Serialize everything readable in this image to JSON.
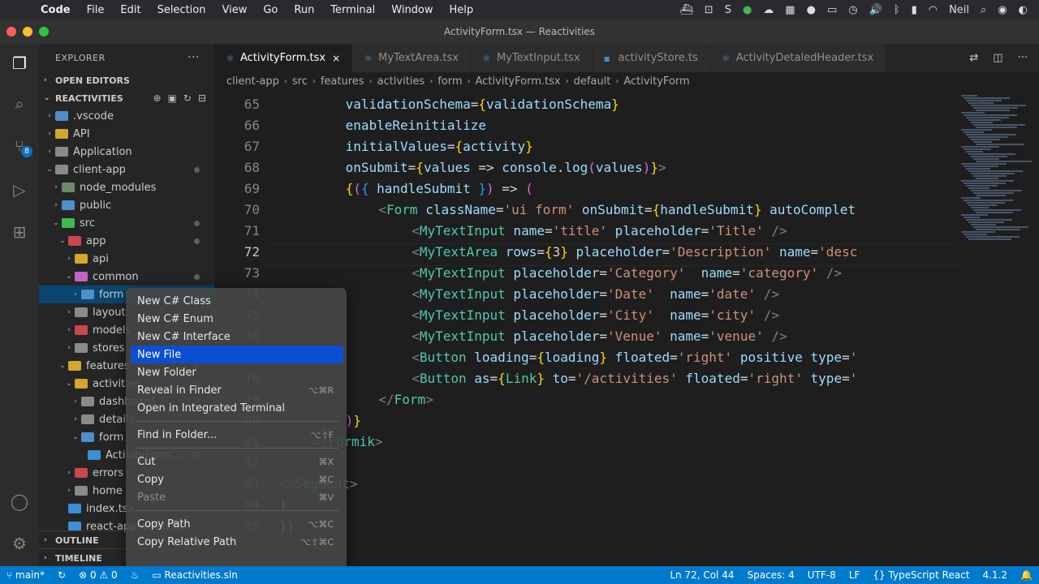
{
  "menubar": {
    "app": "Code",
    "items": [
      "File",
      "Edit",
      "Selection",
      "View",
      "Go",
      "Run",
      "Terminal",
      "Window",
      "Help"
    ],
    "user": "Neil"
  },
  "window": {
    "title": "ActivityForm.tsx — Reactivities"
  },
  "activitybar": {
    "scm_badge": "8"
  },
  "sidebar": {
    "title": "EXPLORER",
    "open_editors": "OPEN EDITORS",
    "project": "REACTIVITIES",
    "tree": [
      {
        "label": ".vscode",
        "depth": 1,
        "chev": "›",
        "color": "#4e8fc9"
      },
      {
        "label": "API",
        "depth": 1,
        "chev": "›",
        "color": "#d4a72c"
      },
      {
        "label": "Application",
        "depth": 1,
        "chev": "›",
        "color": "#8a8a8a"
      },
      {
        "label": "client-app",
        "depth": 1,
        "chev": "⌄",
        "color": "#8a8a8a"
      },
      {
        "label": "node_modules",
        "depth": 2,
        "chev": "›",
        "color": "#6a8a6a"
      },
      {
        "label": "public",
        "depth": 2,
        "chev": "›",
        "color": "#4e8fc9"
      },
      {
        "label": "src",
        "depth": 2,
        "chev": "⌄",
        "color": "#3fb950"
      },
      {
        "label": "app",
        "depth": 3,
        "chev": "⌄",
        "color": "#c9474e"
      },
      {
        "label": "api",
        "depth": 4,
        "chev": "›",
        "color": "#d4a72c"
      },
      {
        "label": "common",
        "depth": 4,
        "chev": "⌄",
        "color": "#c563c5"
      },
      {
        "label": "form",
        "depth": 5,
        "chev": "›",
        "color": "#4e8fc9"
      },
      {
        "label": "layout",
        "depth": 4,
        "chev": "›",
        "color": "#8a8a8a"
      },
      {
        "label": "models",
        "depth": 4,
        "chev": "›",
        "color": "#c9474e"
      },
      {
        "label": "stores",
        "depth": 4,
        "chev": "›",
        "color": "#8a8a8a"
      },
      {
        "label": "features",
        "depth": 3,
        "chev": "⌄",
        "color": "#d4a72c"
      },
      {
        "label": "activities",
        "depth": 4,
        "chev": "⌄",
        "color": "#d4a72c"
      },
      {
        "label": "dashboard",
        "depth": 5,
        "chev": "›",
        "color": "#8a8a8a"
      },
      {
        "label": "details",
        "depth": 5,
        "chev": "›",
        "color": "#8a8a8a"
      },
      {
        "label": "form",
        "depth": 5,
        "chev": "⌄",
        "color": "#4e8fc9"
      },
      {
        "label": "ActivityForm...",
        "depth": 6,
        "chev": "",
        "color": "#3c8fd6",
        "mark": "M"
      },
      {
        "label": "errors",
        "depth": 4,
        "chev": "›",
        "color": "#c9474e"
      },
      {
        "label": "home",
        "depth": 4,
        "chev": "›",
        "color": "#8a8a8a"
      },
      {
        "label": "index.tsx",
        "depth": 3,
        "chev": "",
        "color": "#3c8fd6"
      },
      {
        "label": "react-app-env.d.ts",
        "depth": 3,
        "chev": "",
        "color": "#3c8fd6"
      }
    ],
    "outline": "OUTLINE",
    "timeline": "TIMELINE"
  },
  "tabs": [
    {
      "label": "ActivityForm.tsx",
      "active": true,
      "close": "×"
    },
    {
      "label": "MyTextArea.tsx",
      "active": false
    },
    {
      "label": "MyTextInput.tsx",
      "active": false
    },
    {
      "label": "activityStore.ts",
      "active": false
    },
    {
      "label": "ActivityDetaledHeader.tsx",
      "active": false
    }
  ],
  "breadcrumb": [
    "client-app",
    "src",
    "features",
    "activities",
    "form",
    "ActivityForm.tsx",
    "default",
    "ActivityForm"
  ],
  "editor": {
    "current_line": 72,
    "lines": [
      {
        "n": "65",
        "indent": 8,
        "parts": [
          [
            "k",
            "validationSchema"
          ],
          [
            "w",
            "="
          ],
          [
            "b",
            "{"
          ],
          [
            "k",
            "validationSchema"
          ],
          [
            "b",
            "}"
          ]
        ]
      },
      {
        "n": "66",
        "indent": 8,
        "parts": [
          [
            "k",
            "enableReinitialize"
          ]
        ]
      },
      {
        "n": "67",
        "indent": 8,
        "parts": [
          [
            "k",
            "initialValues"
          ],
          [
            "w",
            "="
          ],
          [
            "b",
            "{"
          ],
          [
            "k",
            "activity"
          ],
          [
            "b",
            "}"
          ]
        ]
      },
      {
        "n": "68",
        "indent": 8,
        "parts": [
          [
            "k",
            "onSubmit"
          ],
          [
            "w",
            "="
          ],
          [
            "b",
            "{"
          ],
          [
            "k",
            "values"
          ],
          [
            "w",
            " => "
          ],
          [
            "k",
            "console"
          ],
          [
            "w",
            "."
          ],
          [
            "k",
            "log"
          ],
          [
            "pk",
            "("
          ],
          [
            "k",
            "values"
          ],
          [
            "pk",
            ")"
          ],
          [
            "b",
            "}"
          ],
          [
            "p",
            ">"
          ]
        ]
      },
      {
        "n": "69",
        "indent": 8,
        "parts": [
          [
            "b",
            "{"
          ],
          [
            "pk",
            "("
          ],
          [
            "bl",
            "{ "
          ],
          [
            "k",
            "handleSubmit"
          ],
          [
            "bl",
            " }"
          ],
          [
            "pk",
            ")"
          ],
          [
            "w",
            " => "
          ],
          [
            "pk",
            "("
          ]
        ]
      },
      {
        "n": "70",
        "indent": 12,
        "parts": [
          [
            "p",
            "<"
          ],
          [
            "t",
            "Form"
          ],
          [
            "k",
            " className"
          ],
          [
            "w",
            "="
          ],
          [
            "s",
            "'ui form'"
          ],
          [
            "k",
            " onSubmit"
          ],
          [
            "w",
            "="
          ],
          [
            "b",
            "{"
          ],
          [
            "k",
            "handleSubmit"
          ],
          [
            "b",
            "}"
          ],
          [
            "k",
            " autoComplet"
          ]
        ]
      },
      {
        "n": "71",
        "indent": 16,
        "parts": [
          [
            "p",
            "<"
          ],
          [
            "t",
            "MyTextInput"
          ],
          [
            "k",
            " name"
          ],
          [
            "w",
            "="
          ],
          [
            "s",
            "'title'"
          ],
          [
            "k",
            " placeholder"
          ],
          [
            "w",
            "="
          ],
          [
            "s",
            "'Title'"
          ],
          [
            "p",
            " />"
          ]
        ]
      },
      {
        "n": "72",
        "indent": 16,
        "parts": [
          [
            "p",
            "<"
          ],
          [
            "t",
            "MyTextArea"
          ],
          [
            "k",
            " rows"
          ],
          [
            "w",
            "="
          ],
          [
            "b",
            "{"
          ],
          [
            "w",
            "3"
          ],
          [
            "b",
            "}"
          ],
          [
            "k",
            " placeholder"
          ],
          [
            "w",
            "="
          ],
          [
            "s",
            "'Description'"
          ],
          [
            "k",
            " name"
          ],
          [
            "w",
            "="
          ],
          [
            "s",
            "'desc"
          ]
        ]
      },
      {
        "n": "73",
        "indent": 16,
        "parts": [
          [
            "p",
            "<"
          ],
          [
            "t",
            "MyTextInput"
          ],
          [
            "k",
            " placeholder"
          ],
          [
            "w",
            "="
          ],
          [
            "s",
            "'Category'"
          ],
          [
            "k",
            "  name"
          ],
          [
            "w",
            "="
          ],
          [
            "s",
            "'category'"
          ],
          [
            "p",
            " />"
          ]
        ]
      },
      {
        "n": "74",
        "indent": 16,
        "parts": [
          [
            "p",
            "<"
          ],
          [
            "t",
            "MyTextInput"
          ],
          [
            "k",
            " placeholder"
          ],
          [
            "w",
            "="
          ],
          [
            "s",
            "'Date'"
          ],
          [
            "k",
            "  name"
          ],
          [
            "w",
            "="
          ],
          [
            "s",
            "'date'"
          ],
          [
            "p",
            " />"
          ]
        ]
      },
      {
        "n": "75",
        "indent": 16,
        "parts": [
          [
            "p",
            "<"
          ],
          [
            "t",
            "MyTextInput"
          ],
          [
            "k",
            " placeholder"
          ],
          [
            "w",
            "="
          ],
          [
            "s",
            "'City'"
          ],
          [
            "k",
            "  name"
          ],
          [
            "w",
            "="
          ],
          [
            "s",
            "'city'"
          ],
          [
            "p",
            " />"
          ]
        ]
      },
      {
        "n": "76",
        "indent": 16,
        "parts": [
          [
            "p",
            "<"
          ],
          [
            "t",
            "MyTextInput"
          ],
          [
            "k",
            " placeholder"
          ],
          [
            "w",
            "="
          ],
          [
            "s",
            "'Venue'"
          ],
          [
            "k",
            " name"
          ],
          [
            "w",
            "="
          ],
          [
            "s",
            "'venue'"
          ],
          [
            "p",
            " />"
          ]
        ]
      },
      {
        "n": "77",
        "indent": 16,
        "parts": [
          [
            "p",
            "<"
          ],
          [
            "t",
            "Button"
          ],
          [
            "k",
            " loading"
          ],
          [
            "w",
            "="
          ],
          [
            "b",
            "{"
          ],
          [
            "k",
            "loading"
          ],
          [
            "b",
            "}"
          ],
          [
            "k",
            " floated"
          ],
          [
            "w",
            "="
          ],
          [
            "s",
            "'right'"
          ],
          [
            "k",
            " positive"
          ],
          [
            "k",
            " type"
          ],
          [
            "w",
            "="
          ],
          [
            "s",
            "'"
          ]
        ]
      },
      {
        "n": "78",
        "indent": 16,
        "parts": [
          [
            "p",
            "<"
          ],
          [
            "t",
            "Button"
          ],
          [
            "k",
            " as"
          ],
          [
            "w",
            "="
          ],
          [
            "b",
            "{"
          ],
          [
            "t",
            "Link"
          ],
          [
            "b",
            "}"
          ],
          [
            "k",
            " to"
          ],
          [
            "w",
            "="
          ],
          [
            "s",
            "'/activities'"
          ],
          [
            "k",
            " floated"
          ],
          [
            "w",
            "="
          ],
          [
            "s",
            "'right'"
          ],
          [
            "k",
            " type"
          ],
          [
            "w",
            "="
          ],
          [
            "s",
            "'"
          ]
        ]
      },
      {
        "n": "79",
        "indent": 12,
        "parts": [
          [
            "p",
            "</"
          ],
          [
            "t",
            "Form"
          ],
          [
            "p",
            ">"
          ]
        ]
      },
      {
        "n": "80",
        "indent": 8,
        "parts": [
          [
            "pk",
            ")"
          ],
          [
            "b",
            "}"
          ]
        ]
      },
      {
        "n": "81",
        "indent": 4,
        "parts": [
          [
            "p",
            "</"
          ],
          [
            "t",
            "Formik"
          ],
          [
            "p",
            ">"
          ]
        ]
      },
      {
        "n": "82",
        "indent": 0,
        "parts": []
      },
      {
        "n": "83",
        "indent": 0,
        "parts": [
          [
            "p",
            "</"
          ],
          [
            "t",
            "Segment"
          ],
          [
            "p",
            ">"
          ]
        ]
      },
      {
        "n": "84",
        "indent": 0,
        "parts": [
          [
            "w",
            ")"
          ]
        ]
      },
      {
        "n": "85",
        "indent": 0,
        "parts": [
          [
            "b",
            "})"
          ]
        ]
      }
    ]
  },
  "context_menu": {
    "items": [
      {
        "label": "New C# Class",
        "shortcut": ""
      },
      {
        "label": "New C# Enum",
        "shortcut": ""
      },
      {
        "label": "New C# Interface",
        "shortcut": ""
      },
      {
        "label": "New File",
        "shortcut": "",
        "highlight": true
      },
      {
        "label": "New Folder",
        "shortcut": ""
      },
      {
        "label": "Reveal in Finder",
        "shortcut": "⌥⌘R"
      },
      {
        "label": "Open in Integrated Terminal",
        "shortcut": ""
      },
      {
        "sep": true
      },
      {
        "label": "Find in Folder...",
        "shortcut": "⌥⇧F"
      },
      {
        "sep": true
      },
      {
        "label": "Cut",
        "shortcut": "⌘X"
      },
      {
        "label": "Copy",
        "shortcut": "⌘C"
      },
      {
        "label": "Paste",
        "shortcut": "⌘V",
        "disabled": true
      },
      {
        "sep": true
      },
      {
        "label": "Copy Path",
        "shortcut": "⌥⌘C"
      },
      {
        "label": "Copy Relative Path",
        "shortcut": "⌥⇧⌘C"
      }
    ]
  },
  "statusbar": {
    "branch": "main*",
    "errors": "0",
    "warnings": "0",
    "solution": "Reactivities.sln",
    "position": "Ln 72, Col 44",
    "spaces": "Spaces: 4",
    "encoding": "UTF-8",
    "eol": "LF",
    "language": "TypeScript React",
    "version": "4.1.2"
  }
}
